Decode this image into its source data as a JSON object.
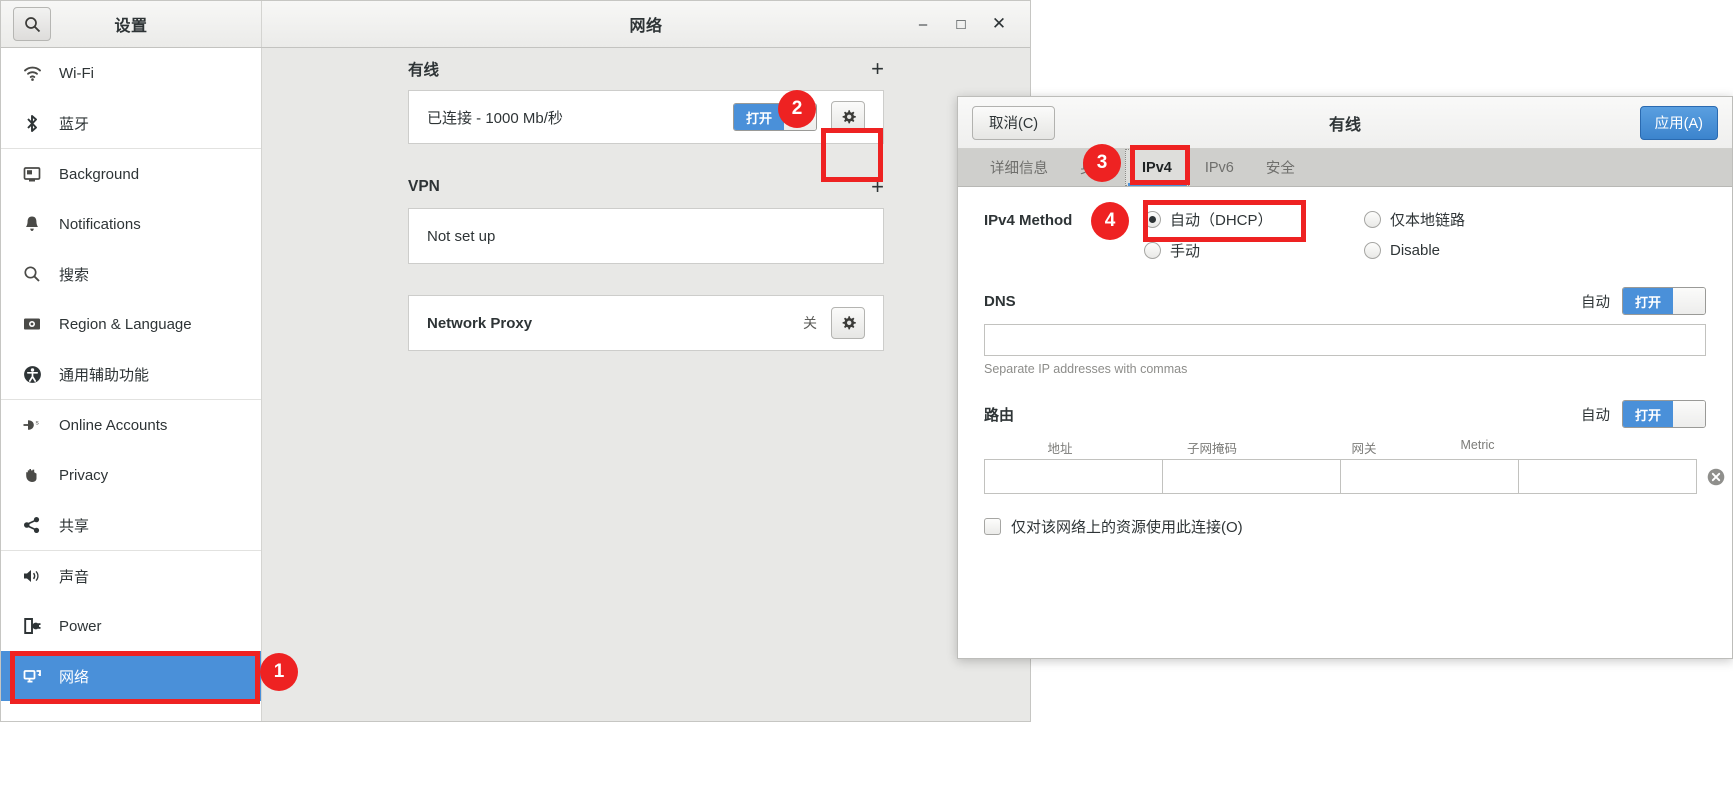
{
  "settings_window": {
    "titlebar": {
      "search_icon": "search-icon",
      "app_title": "设置",
      "panel_title": "网络",
      "minimize": "–",
      "maximize": "□",
      "close": "✕"
    },
    "sidebar": {
      "groups": [
        {
          "items": [
            {
              "icon": "wifi-icon",
              "label": "Wi-Fi",
              "selected": false
            },
            {
              "icon": "bluetooth-icon",
              "label": "蓝牙",
              "selected": false
            }
          ]
        },
        {
          "items": [
            {
              "icon": "background-icon",
              "label": "Background",
              "selected": false
            },
            {
              "icon": "notifications-icon",
              "label": "Notifications",
              "selected": false
            },
            {
              "icon": "search-icon",
              "label": "搜索",
              "selected": false
            },
            {
              "icon": "region-language-icon",
              "label": "Region & Language",
              "selected": false
            },
            {
              "icon": "accessibility-icon",
              "label": "通用辅助功能",
              "selected": false
            }
          ]
        },
        {
          "items": [
            {
              "icon": "online-accounts-icon",
              "label": "Online Accounts",
              "selected": false
            },
            {
              "icon": "privacy-icon",
              "label": "Privacy",
              "selected": false
            },
            {
              "icon": "sharing-icon",
              "label": "共享",
              "selected": false
            }
          ]
        },
        {
          "items": [
            {
              "icon": "sound-icon",
              "label": "声音",
              "selected": false
            },
            {
              "icon": "power-icon",
              "label": "Power",
              "selected": false
            },
            {
              "icon": "network-icon",
              "label": "网络",
              "selected": true
            }
          ]
        }
      ]
    },
    "main_panel": {
      "wired": {
        "section_title": "有线",
        "add_label": "+",
        "status": "已连接 - 1000 Mb/秒",
        "switch_on_label": "打开",
        "gear_icon": "gear-icon"
      },
      "vpn": {
        "section_title": "VPN",
        "add_label": "+",
        "status": "Not set up"
      },
      "proxy": {
        "label": "Network Proxy",
        "state": "关",
        "gear_icon": "gear-icon"
      }
    }
  },
  "dialog": {
    "cancel_label": "取消(C)",
    "title": "有线",
    "apply_label": "应用(A)",
    "tabs": [
      {
        "label": "详细信息",
        "active": false
      },
      {
        "label": "身份",
        "active": false
      },
      {
        "label": "IPv4",
        "active": true
      },
      {
        "label": "IPv6",
        "active": false
      },
      {
        "label": "安全",
        "active": false
      }
    ],
    "ipv4_method": {
      "label": "IPv4 Method",
      "options": [
        {
          "label": "自动（DHCP）",
          "checked": true
        },
        {
          "label": "仅本地链路",
          "checked": false
        },
        {
          "label": "手动",
          "checked": false
        },
        {
          "label": "Disable",
          "checked": false
        }
      ]
    },
    "dns": {
      "title": "DNS",
      "auto_label": "自动",
      "switch_on_label": "打开",
      "value": "",
      "hint": "Separate IP addresses with commas"
    },
    "routes": {
      "title": "路由",
      "auto_label": "自动",
      "switch_on_label": "打开",
      "columns": [
        "地址",
        "子网掩码",
        "网关",
        "Metric"
      ],
      "rows": [
        {
          "address": "",
          "netmask": "",
          "gateway": "",
          "metric": ""
        }
      ],
      "clear_icon": "clear-icon"
    },
    "restrict_checkbox": {
      "label": "仅对该网络上的资源使用此连接(O)",
      "checked": false
    }
  },
  "annotations": {
    "colors": {
      "marker": "#ee2222",
      "accent": "#4a90d9"
    },
    "badges": [
      {
        "number": "1"
      },
      {
        "number": "2"
      },
      {
        "number": "3"
      },
      {
        "number": "4"
      }
    ]
  }
}
